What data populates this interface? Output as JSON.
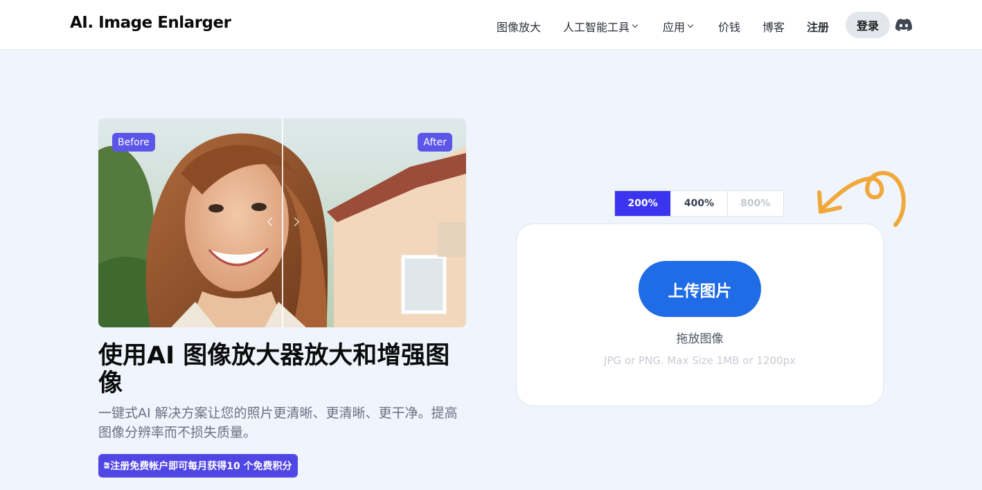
{
  "header": {
    "logo": "AI. Image Enlarger",
    "nav": [
      {
        "label": "图像放大",
        "dropdown": false
      },
      {
        "label": "人工智能工具",
        "dropdown": true
      },
      {
        "label": "应用",
        "dropdown": true
      },
      {
        "label": "价钱",
        "dropdown": false
      },
      {
        "label": "博客",
        "dropdown": false
      },
      {
        "label": "注册",
        "dropdown": false
      }
    ],
    "login_label": "登录",
    "discord_icon": "discord-icon"
  },
  "hero": {
    "before_label": "Before",
    "after_label": "After",
    "headline": "使用AI 图像放大器放大和增强图像",
    "subtext": "一键式AI 解决方案让您的照片更清晰、更清晰、更干净。提高图像分辨率而不损失质量。",
    "promo": "注册免费帐户即可每月获得10 个免费积分"
  },
  "upload": {
    "scales": [
      {
        "label": "200%",
        "state": "selected"
      },
      {
        "label": "400%",
        "state": "normal"
      },
      {
        "label": "800%",
        "state": "disabled"
      }
    ],
    "button_label": "上传图片",
    "drop_text": "拖放图像",
    "hint": "JPG or PNG. Max Size 1MB or 1200px"
  },
  "colors": {
    "accent": "#3b35f0",
    "upload_button": "#1f6ce6",
    "tag": "#5b55e8",
    "promo": "#4f46e5",
    "squiggle": "#f0a83a",
    "page_bg": "#eff4fd"
  }
}
